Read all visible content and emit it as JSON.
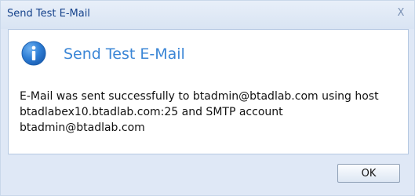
{
  "window": {
    "title": "Send Test E-Mail",
    "close_label": "X"
  },
  "dialog": {
    "icon": "info-icon",
    "heading": "Send Test E-Mail",
    "message": "E-Mail was sent successfully to btadmin@btadlab.com using host btadlabex10.btadlab.com:25 and SMTP account btadmin@btadlab.com"
  },
  "buttons": {
    "ok_label": "OK"
  },
  "colors": {
    "title_text": "#15428b",
    "heading": "#3b86d6",
    "info_icon": "#2f7fd6",
    "frame": "#dfe8f6"
  }
}
